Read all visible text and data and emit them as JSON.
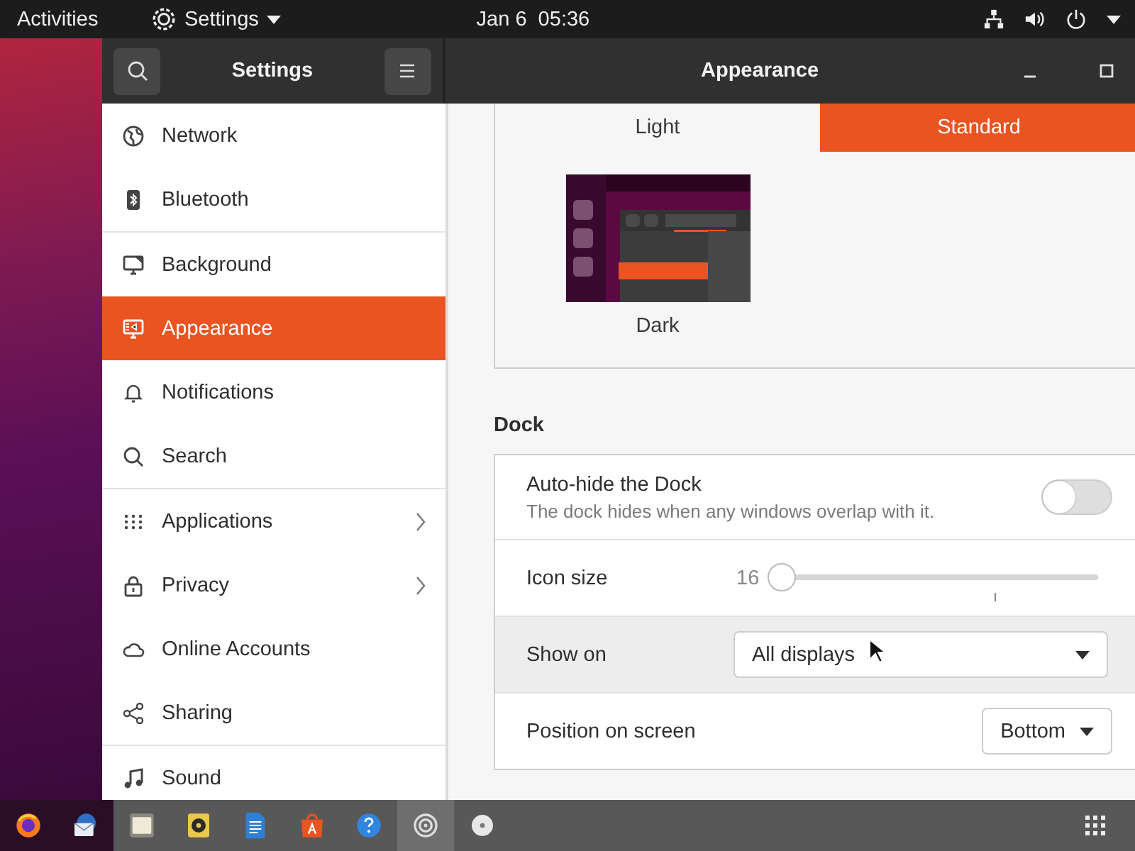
{
  "top_bar": {
    "activities": "Activities",
    "app_menu": "Settings",
    "clock": "Jan 6  05:36"
  },
  "window": {
    "sidebar_title": "Settings",
    "title": "Appearance"
  },
  "sidebar": {
    "groups": [
      [
        {
          "label": "Network",
          "kind": "globe",
          "selected": false,
          "chevron": false
        },
        {
          "label": "Bluetooth",
          "kind": "bluetooth",
          "selected": false,
          "chevron": false
        }
      ],
      [
        {
          "label": "Background",
          "kind": "monitor",
          "selected": false,
          "chevron": false
        },
        {
          "label": "Appearance",
          "kind": "appearance",
          "selected": true,
          "chevron": false
        },
        {
          "label": "Notifications",
          "kind": "bell",
          "selected": false,
          "chevron": false
        },
        {
          "label": "Search",
          "kind": "search",
          "selected": false,
          "chevron": false
        }
      ],
      [
        {
          "label": "Applications",
          "kind": "grid",
          "selected": false,
          "chevron": true
        },
        {
          "label": "Privacy",
          "kind": "lock",
          "selected": false,
          "chevron": true
        },
        {
          "label": "Online Accounts",
          "kind": "cloud",
          "selected": false,
          "chevron": false
        },
        {
          "label": "Sharing",
          "kind": "share",
          "selected": false,
          "chevron": false
        }
      ],
      [
        {
          "label": "Sound",
          "kind": "music",
          "selected": false,
          "chevron": false
        }
      ]
    ]
  },
  "themes": [
    {
      "label": "Light",
      "kind": "label",
      "selected": false
    },
    {
      "label": "Standard",
      "kind": "label",
      "selected": true
    },
    {
      "label": "Dark",
      "kind": "thumbnail",
      "selected": false
    }
  ],
  "dock_section": {
    "heading": "Dock",
    "rows": [
      {
        "kind": "switch",
        "label": "Auto-hide the Dock",
        "description": "The dock hides when any windows overlap with it.",
        "on": false,
        "highlighted": false
      },
      {
        "kind": "slider",
        "label": "Icon size",
        "reading": "16",
        "level": 0,
        "highlighted": false
      },
      {
        "kind": "dropdown",
        "label": "Show on",
        "value": "All displays",
        "wide": true,
        "highlighted": true
      },
      {
        "kind": "dropdown",
        "label": "Position on screen",
        "value": "Bottom",
        "wide": false,
        "highlighted": false
      }
    ]
  },
  "taskbar": {
    "items": [
      {
        "kind": "browser",
        "active": false
      },
      {
        "kind": "mail",
        "active": false
      },
      {
        "kind": "files",
        "active": false
      },
      {
        "kind": "speaker",
        "active": false
      },
      {
        "kind": "document",
        "active": false
      },
      {
        "kind": "bag",
        "active": false
      },
      {
        "kind": "help",
        "active": false
      },
      {
        "kind": "gear",
        "active": true
      },
      {
        "kind": "disc",
        "active": false
      }
    ]
  }
}
